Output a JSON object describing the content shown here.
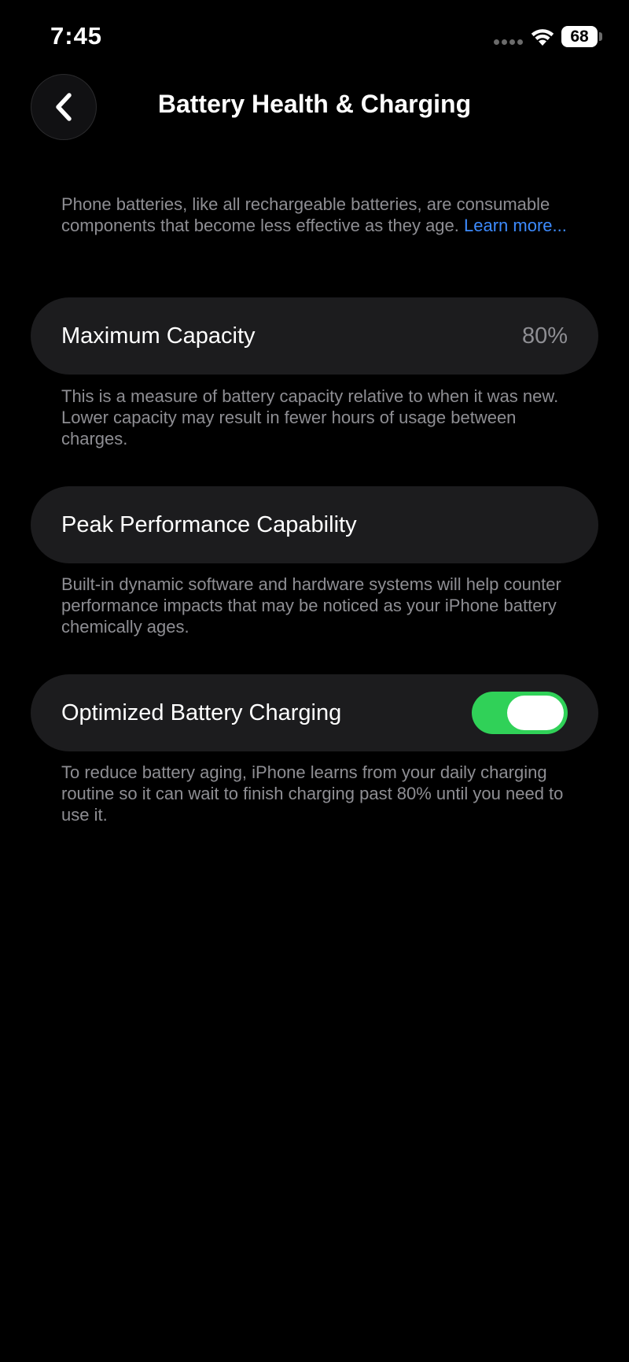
{
  "status_bar": {
    "time": "7:45",
    "battery_level": "68",
    "icons": [
      "signal-dots-icon",
      "wifi-icon",
      "battery-icon"
    ]
  },
  "nav": {
    "back_icon": "chevron-left-icon",
    "title": "Battery Health & Charging"
  },
  "intro": {
    "text": "Phone batteries, like all rechargeable batteries, are consumable components that become less effective as they age. ",
    "link": "Learn more..."
  },
  "maximum_capacity": {
    "label": "Maximum Capacity",
    "value": "80%",
    "footnote": "This is a measure of battery capacity relative to when it was new. Lower capacity may result in fewer hours of usage between charges."
  },
  "peak_performance": {
    "label": "Peak Performance Capability",
    "footnote": "Built-in dynamic software and hardware systems will help counter performance impacts that may be noticed as your iPhone battery chemically ages."
  },
  "optimized_charging": {
    "label": "Optimized Battery Charging",
    "enabled": true,
    "footnote": "To reduce battery aging, iPhone learns from your daily charging routine so it can wait to finish charging past 80% until you need to use it."
  },
  "colors": {
    "background": "#000000",
    "card": "#1c1c1e",
    "secondary_text": "#8e8e93",
    "link": "#3d8bff",
    "toggle_on": "#30d158"
  }
}
